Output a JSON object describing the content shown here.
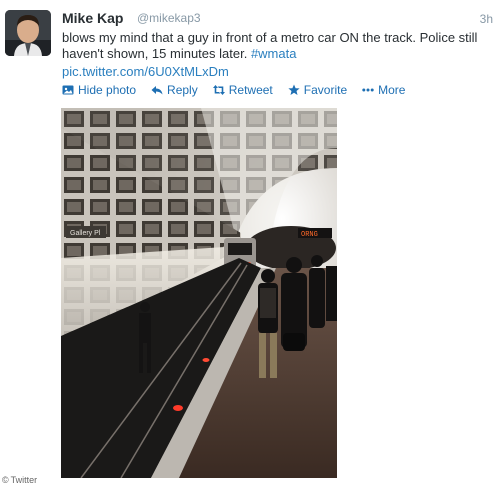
{
  "tweet": {
    "author_name": "Mike Kap",
    "handle": "@mikekap3",
    "time": "3h",
    "text_before": "blows my mind that a guy in front of a metro car ON the track. Police still haven't shown, 15 minutes later. ",
    "hashtag": "#wmata",
    "photo_link": "pic.twitter.com/6U0XtMLxDm"
  },
  "actions": {
    "hide_photo": "Hide photo",
    "reply": "Reply",
    "retweet": "Retweet",
    "favorite": "Favorite",
    "more": "More"
  },
  "photo": {
    "station_sign": "Gallery Pl",
    "train_sign": "ORNG"
  },
  "watermark": {
    "symbol": "©",
    "text": "Twitter"
  },
  "colors": {
    "link": "#2a7fbf",
    "action": "#1e6fb3",
    "meta": "#8899a6"
  }
}
